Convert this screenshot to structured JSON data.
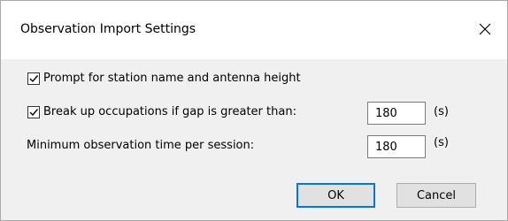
{
  "dialog": {
    "title": "Observation Import Settings",
    "close_icon": "close-icon"
  },
  "options": {
    "prompt_station": {
      "checked": true,
      "label": "Prompt for station name and antenna height"
    },
    "break_occupations": {
      "checked": true,
      "label": "Break up occupations if gap is greater than:",
      "value": "180",
      "unit": "(s)"
    },
    "min_observation": {
      "label": "Minimum observation time per session:",
      "value": "180",
      "unit": "(s)"
    }
  },
  "buttons": {
    "ok": "OK",
    "cancel": "Cancel"
  },
  "colors": {
    "accent": "#0078d7",
    "dialog_bg": "#f0f0f0"
  }
}
